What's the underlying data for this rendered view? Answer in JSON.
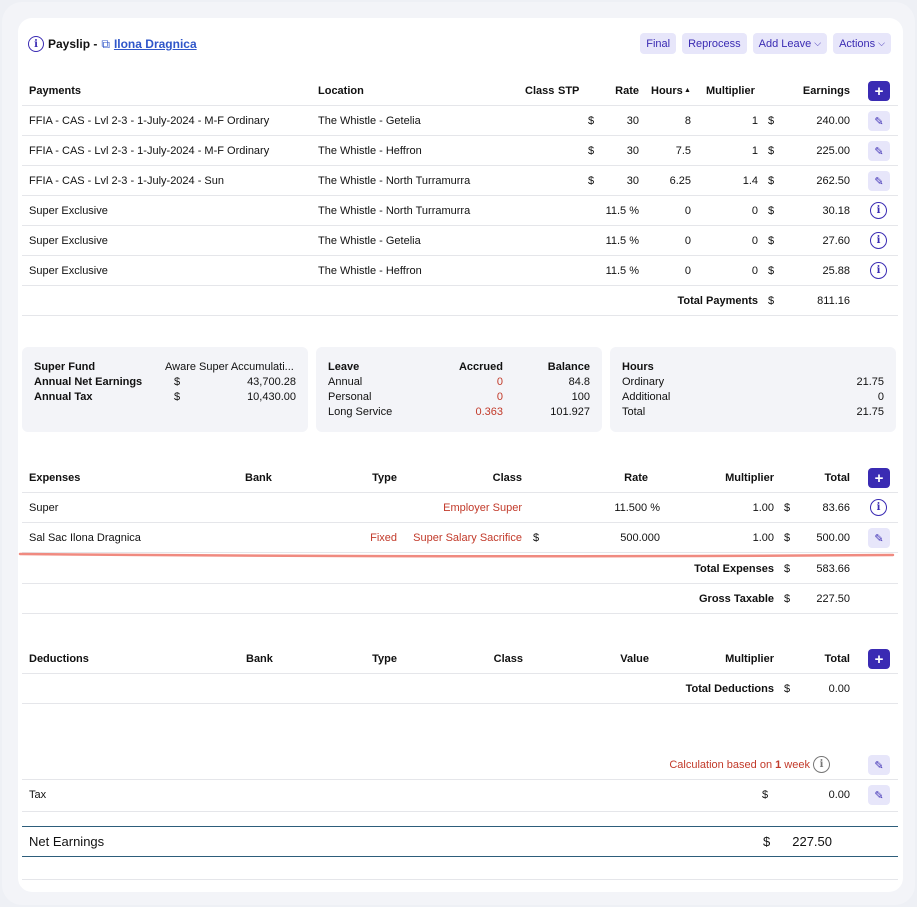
{
  "header": {
    "title": "Payslip - ",
    "employee": "Ilona Dragnica",
    "buttons": [
      "Final",
      "Reprocess",
      "Add Leave",
      "Actions"
    ]
  },
  "payments": {
    "headers": [
      "Payments",
      "Location",
      "Class",
      "STP",
      "Rate",
      "Hours",
      "Multiplier",
      "Earnings"
    ],
    "sort_indicator": "▲",
    "rows": [
      {
        "payment": "FFIA - CAS - Lvl 2-3 - 1-July-2024 - M-F Ordinary",
        "location": "The Whistle - Getelia",
        "rate_cur": "$",
        "rate": "30",
        "hours": "8",
        "mult": "1",
        "earn_cur": "$",
        "earnings": "240.00",
        "action": "edit"
      },
      {
        "payment": "FFIA - CAS - Lvl 2-3 - 1-July-2024 - M-F Ordinary",
        "location": "The Whistle - Heffron",
        "rate_cur": "$",
        "rate": "30",
        "hours": "7.5",
        "mult": "1",
        "earn_cur": "$",
        "earnings": "225.00",
        "action": "edit"
      },
      {
        "payment": "FFIA - CAS - Lvl 2-3 - 1-July-2024 - Sun",
        "location": "The Whistle - North Turramurra",
        "rate_cur": "$",
        "rate": "30",
        "hours": "6.25",
        "mult": "1.4",
        "earn_cur": "$",
        "earnings": "262.50",
        "action": "edit"
      },
      {
        "payment": "Super Exclusive",
        "location": "The Whistle - North Turramurra",
        "rate_cur": "",
        "rate": "11.5 %",
        "hours": "0",
        "mult": "0",
        "earn_cur": "$",
        "earnings": "30.18",
        "action": "info"
      },
      {
        "payment": "Super Exclusive",
        "location": "The Whistle - Getelia",
        "rate_cur": "",
        "rate": "11.5 %",
        "hours": "0",
        "mult": "0",
        "earn_cur": "$",
        "earnings": "27.60",
        "action": "info"
      },
      {
        "payment": "Super Exclusive",
        "location": "The Whistle - Heffron",
        "rate_cur": "",
        "rate": "11.5 %",
        "hours": "0",
        "mult": "0",
        "earn_cur": "$",
        "earnings": "25.88",
        "action": "info"
      }
    ],
    "total_label": "Total Payments",
    "total_cur": "$",
    "total": "811.16"
  },
  "summary": {
    "fund": {
      "l1": "Super Fund",
      "v1": "Aware Super Accumulati...",
      "l2": "Annual Net Earnings",
      "c2": "$",
      "v2": "43,700.28",
      "l3": "Annual Tax",
      "c3": "$",
      "v3": "10,430.00"
    },
    "leave": {
      "h1": "Leave",
      "h2": "Accrued",
      "h3": "Balance",
      "rows": [
        {
          "n": "Annual",
          "a": "0",
          "b": "84.8"
        },
        {
          "n": "Personal",
          "a": "0",
          "b": "100"
        },
        {
          "n": "Long Service",
          "a": "0.363",
          "b": "101.927"
        }
      ]
    },
    "hours": {
      "h": "Hours",
      "rows": [
        {
          "n": "Ordinary",
          "v": "21.75"
        },
        {
          "n": "Additional",
          "v": "0"
        },
        {
          "n": "Total",
          "v": "21.75"
        }
      ]
    }
  },
  "expenses": {
    "headers": [
      "Expenses",
      "Bank",
      "Type",
      "Class",
      "Rate",
      "Multiplier",
      "Total"
    ],
    "rows": [
      {
        "name": "Super",
        "type": "",
        "cls": "Employer Super",
        "rate_cur": "",
        "rate": "11.500 %",
        "mult": "1.00",
        "cur": "$",
        "total": "83.66",
        "action": "info"
      },
      {
        "name": "Sal Sac Ilona Dragnica",
        "type": "Fixed",
        "cls": "Super Salary Sacrifice",
        "rate_cur": "$",
        "rate": "500.000",
        "mult": "1.00",
        "cur": "$",
        "total": "500.00",
        "action": "edit"
      }
    ],
    "total_label": "Total Expenses",
    "total_cur": "$",
    "total": "583.66",
    "gross_label": "Gross Taxable",
    "gross_cur": "$",
    "gross": "227.50"
  },
  "deductions": {
    "headers": [
      "Deductions",
      "Bank",
      "Type",
      "Class",
      "Value",
      "Multiplier",
      "Total"
    ],
    "total_label": "Total Deductions",
    "total_cur": "$",
    "total": "0.00"
  },
  "tax": {
    "calc_pre": "Calculation based on ",
    "calc_num": "1",
    "calc_post": " week",
    "label": "Tax",
    "cur": "$",
    "value": "0.00"
  },
  "net": {
    "label": "Net Earnings",
    "cur": "$",
    "value": "227.50"
  },
  "colors": {
    "accent": "#3a2bb3",
    "red": "#c23a2a",
    "teal": "#2d5d7b"
  }
}
